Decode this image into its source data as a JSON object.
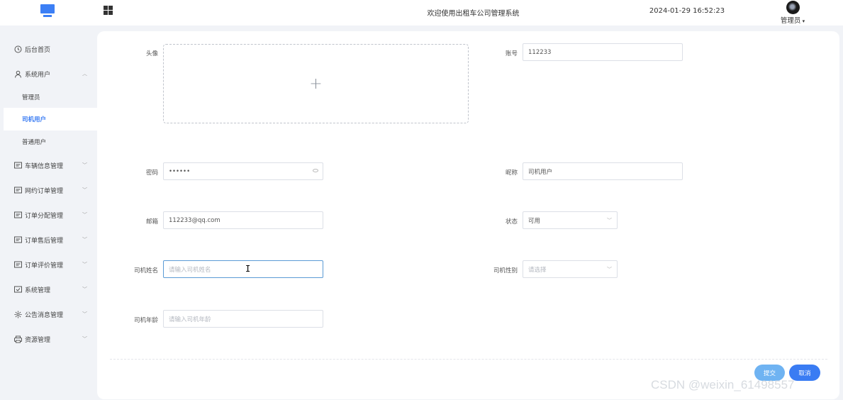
{
  "header": {
    "welcome": "欢迎使用出租车公司管理系统",
    "datetime": "2024-01-29 16:52:23",
    "username": "管理员",
    "logo_icon": "monitor-icon",
    "menu_icon": "grid-icon",
    "accent": "#3a7cf3"
  },
  "sidebar": {
    "items": [
      {
        "label": "后台首页",
        "icon": "clock-icon"
      },
      {
        "label": "系统用户",
        "icon": "user-icon",
        "expanded": true
      },
      {
        "label": "车辆信息管理",
        "icon": "card-icon"
      },
      {
        "label": "网约订单管理",
        "icon": "card-icon"
      },
      {
        "label": "订单分配管理",
        "icon": "card-icon"
      },
      {
        "label": "订单售后管理",
        "icon": "card-icon"
      },
      {
        "label": "订单评价管理",
        "icon": "card-icon"
      },
      {
        "label": "系统管理",
        "icon": "checkbox-icon"
      },
      {
        "label": "公告消息管理",
        "icon": "sun-icon"
      },
      {
        "label": "资源管理",
        "icon": "printer-icon"
      }
    ],
    "subitems": [
      {
        "label": "管理员"
      },
      {
        "label": "司机用户",
        "active": true
      },
      {
        "label": "普通用户"
      }
    ]
  },
  "form": {
    "avatar_label": "头像",
    "account_label": "账号",
    "account_value": "112233",
    "password_label": "密码",
    "password_value": "••••••",
    "nickname_label": "昵称",
    "nickname_value": "司机用户",
    "email_label": "邮箱",
    "email_value": "112233@qq.com",
    "status_label": "状态",
    "status_value": "可用",
    "driver_name_label": "司机姓名",
    "driver_name_placeholder": "请输入司机姓名",
    "driver_gender_label": "司机性别",
    "driver_gender_placeholder": "请选择",
    "driver_age_label": "司机年龄",
    "driver_age_placeholder": "请输入司机年龄"
  },
  "actions": {
    "submit": "提交",
    "cancel": "取消"
  },
  "watermark": "CSDN @weixin_61498557"
}
